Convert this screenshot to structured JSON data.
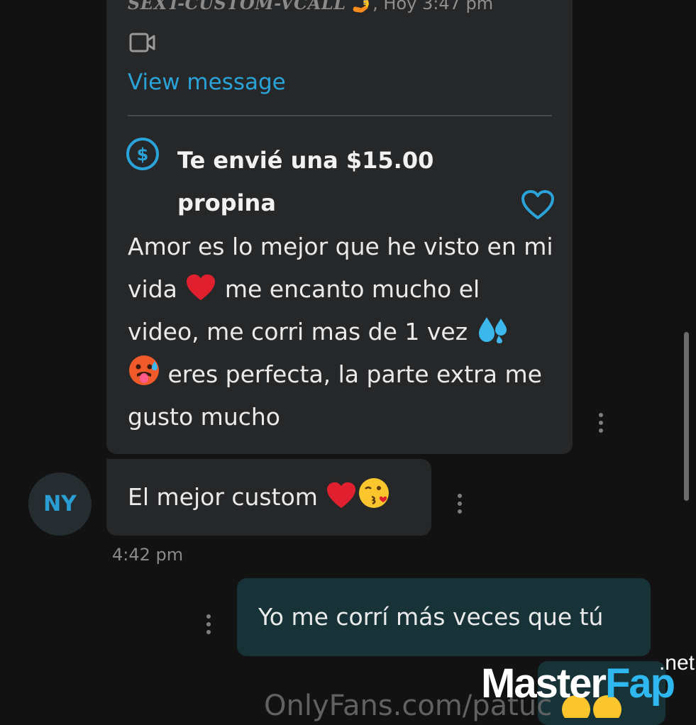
{
  "incoming_tip_message": {
    "sender_caption": "SEXT-CUSTOM-VCALL",
    "sender_caption_emoji": "🤳",
    "time_suffix": ", Hoy 3:47 pm",
    "view_link": "View message",
    "tip_line": "Te envié una $15.00 propina",
    "body_parts": [
      "Amor es lo mejor que he visto en mi vida",
      " me encanto mucho el video, me corri mas de 1 vez",
      " ",
      " eres perfecta, la parte extra me gusto mucho"
    ]
  },
  "incoming_message_2": {
    "avatar_initials": "NY",
    "text": "El mejor custom",
    "time": "4:42 pm"
  },
  "outgoing_message": {
    "text": "Yo me corrí más veces que tú"
  },
  "footer": {
    "watermark": "OnlyFans.com/patuc"
  },
  "overlay_logo": {
    "net": ".net",
    "word_1": "Master",
    "word_2": "Fap"
  },
  "colors": {
    "accent": "#2aa3d9",
    "bubble_incoming": "#252729",
    "bubble_outgoing": "#173338",
    "heart": "#e0202e"
  }
}
